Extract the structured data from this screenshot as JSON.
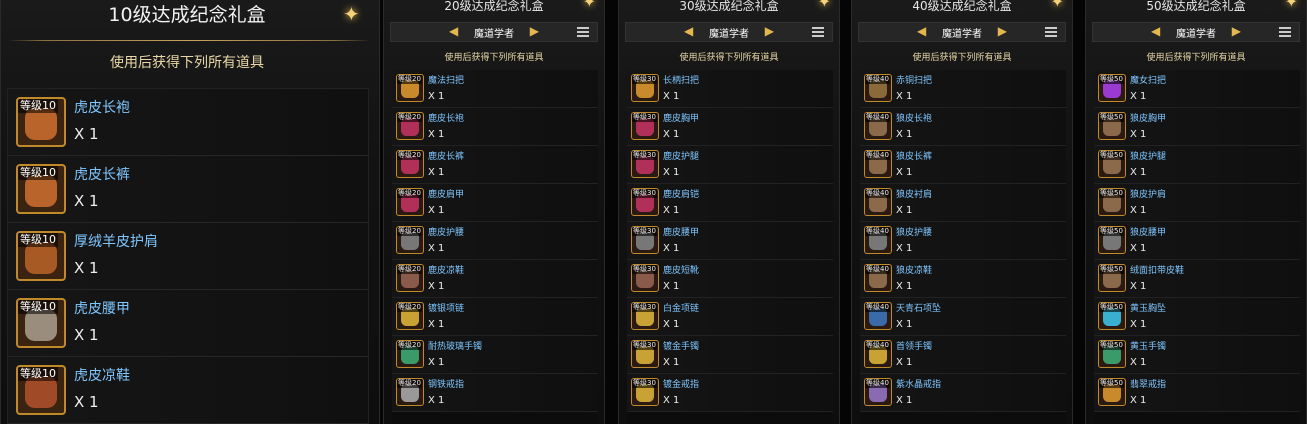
{
  "panels": [
    {
      "title": "10级达成纪念礼盒",
      "subtitle": "使用后获得下列所有道具",
      "items": [
        {
          "level": "等级10",
          "name": "虎皮长袍",
          "qty": "X 1",
          "color": "#b8642a"
        },
        {
          "level": "等级10",
          "name": "虎皮长裤",
          "qty": "X 1",
          "color": "#b8642a"
        },
        {
          "level": "等级10",
          "name": "厚绒羊皮护肩",
          "qty": "X 1",
          "color": "#a85a24"
        },
        {
          "level": "等级10",
          "name": "虎皮腰甲",
          "qty": "X 1",
          "color": "#9a8d7d"
        },
        {
          "level": "等级10",
          "name": "虎皮凉鞋",
          "qty": "X 1",
          "color": "#a04a28"
        }
      ]
    },
    {
      "title": "20级达成纪念礼盒",
      "class_name": "魔道学者",
      "subtitle": "使用后获得下列所有道具",
      "items": [
        {
          "level": "等级20",
          "name": "魔法扫把",
          "qty": "X 1",
          "color": "#c88a2a"
        },
        {
          "level": "等级20",
          "name": "鹿皮长袍",
          "qty": "X 1",
          "color": "#b0305a"
        },
        {
          "level": "等级20",
          "name": "鹿皮长裤",
          "qty": "X 1",
          "color": "#b0305a"
        },
        {
          "level": "等级20",
          "name": "鹿皮肩甲",
          "qty": "X 1",
          "color": "#b0305a"
        },
        {
          "level": "等级20",
          "name": "鹿皮护腰",
          "qty": "X 1",
          "color": "#777777"
        },
        {
          "level": "等级20",
          "name": "鹿皮凉鞋",
          "qty": "X 1",
          "color": "#8a5a4a"
        },
        {
          "level": "等级20",
          "name": "镀银项链",
          "qty": "X 1",
          "color": "#c9a235"
        },
        {
          "level": "等级20",
          "name": "耐热玻璃手镯",
          "qty": "X 1",
          "color": "#3a9a6a"
        },
        {
          "level": "等级20",
          "name": "钢铁戒指",
          "qty": "X 1",
          "color": "#999999"
        }
      ]
    },
    {
      "title": "30级达成纪念礼盒",
      "class_name": "魔道学者",
      "subtitle": "使用后获得下列所有道具",
      "items": [
        {
          "level": "等级30",
          "name": "长柄扫把",
          "qty": "X 1",
          "color": "#c88a2a"
        },
        {
          "level": "等级30",
          "name": "鹿皮胸甲",
          "qty": "X 1",
          "color": "#b0305a"
        },
        {
          "level": "等级30",
          "name": "鹿皮护腿",
          "qty": "X 1",
          "color": "#b0305a"
        },
        {
          "level": "等级30",
          "name": "鹿皮肩铠",
          "qty": "X 1",
          "color": "#b0305a"
        },
        {
          "level": "等级30",
          "name": "鹿皮腰甲",
          "qty": "X 1",
          "color": "#777777"
        },
        {
          "level": "等级30",
          "name": "鹿皮短靴",
          "qty": "X 1",
          "color": "#8a5a4a"
        },
        {
          "level": "等级30",
          "name": "白金项链",
          "qty": "X 1",
          "color": "#c9a235"
        },
        {
          "level": "等级30",
          "name": "镀金手镯",
          "qty": "X 1",
          "color": "#c9a235"
        },
        {
          "level": "等级30",
          "name": "镀金戒指",
          "qty": "X 1",
          "color": "#c9a235"
        }
      ]
    },
    {
      "title": "40级达成纪念礼盒",
      "class_name": "魔道学者",
      "subtitle": "使用后获得下列所有道具",
      "items": [
        {
          "level": "等级40",
          "name": "赤铜扫把",
          "qty": "X 1",
          "color": "#8a6a3a"
        },
        {
          "level": "等级40",
          "name": "狼皮长袍",
          "qty": "X 1",
          "color": "#8a6a4a"
        },
        {
          "level": "等级40",
          "name": "狼皮长裤",
          "qty": "X 1",
          "color": "#8a6a4a"
        },
        {
          "level": "等级40",
          "name": "狼皮衬肩",
          "qty": "X 1",
          "color": "#8a6a4a"
        },
        {
          "level": "等级40",
          "name": "狼皮护腰",
          "qty": "X 1",
          "color": "#777777"
        },
        {
          "level": "等级40",
          "name": "狼皮凉鞋",
          "qty": "X 1",
          "color": "#8a6a4a"
        },
        {
          "level": "等级40",
          "name": "天青石项坠",
          "qty": "X 1",
          "color": "#3a6aa8"
        },
        {
          "level": "等级40",
          "name": "首领手镯",
          "qty": "X 1",
          "color": "#c9a235"
        },
        {
          "level": "等级40",
          "name": "紫水晶戒指",
          "qty": "X 1",
          "color": "#8a6ab0"
        }
      ]
    },
    {
      "title": "50级达成纪念礼盒",
      "class_name": "魔道学者",
      "subtitle": "使用后获得下列所有道具",
      "items": [
        {
          "level": "等级50",
          "name": "魔女扫把",
          "qty": "X 1",
          "color": "#9a3ad0"
        },
        {
          "level": "等级50",
          "name": "狼皮胸甲",
          "qty": "X 1",
          "color": "#8a6a4a"
        },
        {
          "level": "等级50",
          "name": "狼皮护腿",
          "qty": "X 1",
          "color": "#8a6a4a"
        },
        {
          "level": "等级50",
          "name": "狼皮护肩",
          "qty": "X 1",
          "color": "#8a6a4a"
        },
        {
          "level": "等级50",
          "name": "狼皮腰甲",
          "qty": "X 1",
          "color": "#777777"
        },
        {
          "level": "等级50",
          "name": "绒面扣带皮鞋",
          "qty": "X 1",
          "color": "#8a6a4a"
        },
        {
          "level": "等级50",
          "name": "黄玉胸坠",
          "qty": "X 1",
          "color": "#3ab0d0"
        },
        {
          "level": "等级50",
          "name": "黄玉手镯",
          "qty": "X 1",
          "color": "#3a9a6a"
        },
        {
          "level": "等级50",
          "name": "翡翠戒指",
          "qty": "X 1",
          "color": "#c88a2a"
        }
      ]
    }
  ],
  "icons": {
    "star": "sparkle-star-icon",
    "list": "list-icon",
    "prev": "arrow-left-icon",
    "next": "arrow-right-icon"
  },
  "colors": {
    "accent_gold": "#e3b64f",
    "item_name": "#7fc6ff",
    "subtitle": "#e8d7a8"
  }
}
